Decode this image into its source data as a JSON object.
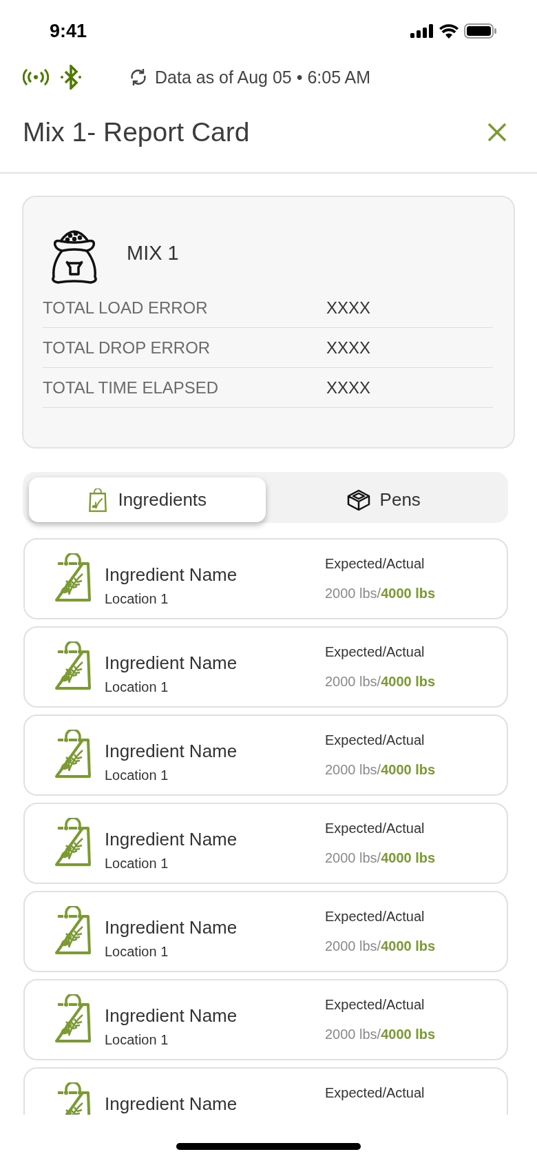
{
  "status_bar": {
    "time": "9:41"
  },
  "sync": {
    "text": "Data as of Aug 05 • 6:05 AM"
  },
  "header": {
    "title": "Mix 1- Report Card"
  },
  "summary": {
    "name": "MIX 1",
    "rows": [
      {
        "label": "TOTAL LOAD ERROR",
        "value": "XXXX"
      },
      {
        "label": "TOTAL DROP ERROR",
        "value": "XXXX"
      },
      {
        "label": "TOTAL TIME ELAPSED",
        "value": "XXXX"
      }
    ]
  },
  "tabs": [
    {
      "label": "Ingredients",
      "selected": true
    },
    {
      "label": "Pens",
      "selected": false
    }
  ],
  "ingredients": [
    {
      "name": "Ingredient Name",
      "location": "Location 1",
      "heading": "Expected/Actual",
      "expected": "2000 lbs/",
      "actual": "4000 lbs"
    },
    {
      "name": "Ingredient Name",
      "location": "Location 1",
      "heading": "Expected/Actual",
      "expected": "2000 lbs/",
      "actual": "4000 lbs"
    },
    {
      "name": "Ingredient Name",
      "location": "Location 1",
      "heading": "Expected/Actual",
      "expected": "2000 lbs/",
      "actual": "4000 lbs"
    },
    {
      "name": "Ingredient Name",
      "location": "Location 1",
      "heading": "Expected/Actual",
      "expected": "2000 lbs/",
      "actual": "4000 lbs"
    },
    {
      "name": "Ingredient Name",
      "location": "Location 1",
      "heading": "Expected/Actual",
      "expected": "2000 lbs/",
      "actual": "4000 lbs"
    },
    {
      "name": "Ingredient Name",
      "location": "Location 1",
      "heading": "Expected/Actual",
      "expected": "2000 lbs/",
      "actual": "4000 lbs"
    },
    {
      "name": "Ingredient Name",
      "heading": "Expected/Actual"
    }
  ]
}
